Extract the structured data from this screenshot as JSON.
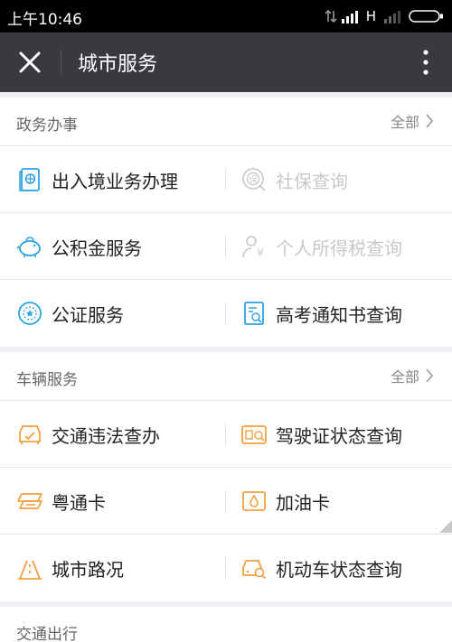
{
  "status": {
    "time": "上午10:46",
    "network": "H"
  },
  "titlebar": {
    "title": "城市服务"
  },
  "sections": [
    {
      "title": "政务办事",
      "all_label": "全部",
      "rows": [
        [
          {
            "label": "出入境业务办理",
            "icon": "passport-icon",
            "disabled": false
          },
          {
            "label": "社保查询",
            "icon": "social-security-icon",
            "disabled": true
          }
        ],
        [
          {
            "label": "公积金服务",
            "icon": "piggy-bank-icon",
            "disabled": false
          },
          {
            "label": "个人所得税查询",
            "icon": "tax-person-icon",
            "disabled": true
          }
        ],
        [
          {
            "label": "公证服务",
            "icon": "notary-seal-icon",
            "disabled": false
          },
          {
            "label": "高考通知书查询",
            "icon": "exam-document-icon",
            "disabled": false
          }
        ]
      ]
    },
    {
      "title": "车辆服务",
      "all_label": "全部",
      "rows": [
        [
          {
            "label": "交通违法查办",
            "icon": "traffic-violation-icon",
            "disabled": false
          },
          {
            "label": "驾驶证状态查询",
            "icon": "driver-license-icon",
            "disabled": false
          }
        ],
        [
          {
            "label": "粤通卡",
            "icon": "toll-card-icon",
            "disabled": false
          },
          {
            "label": "加油卡",
            "icon": "fuel-card-icon",
            "disabled": false
          }
        ],
        [
          {
            "label": "城市路况",
            "icon": "road-condition-icon",
            "disabled": false
          },
          {
            "label": "机动车状态查询",
            "icon": "vehicle-status-icon",
            "disabled": false
          }
        ]
      ]
    },
    {
      "title": "交通出行",
      "rows": []
    }
  ],
  "colors": {
    "blue": "#2aa2e0",
    "orange": "#f0a040",
    "disabled": "#cccccc"
  }
}
